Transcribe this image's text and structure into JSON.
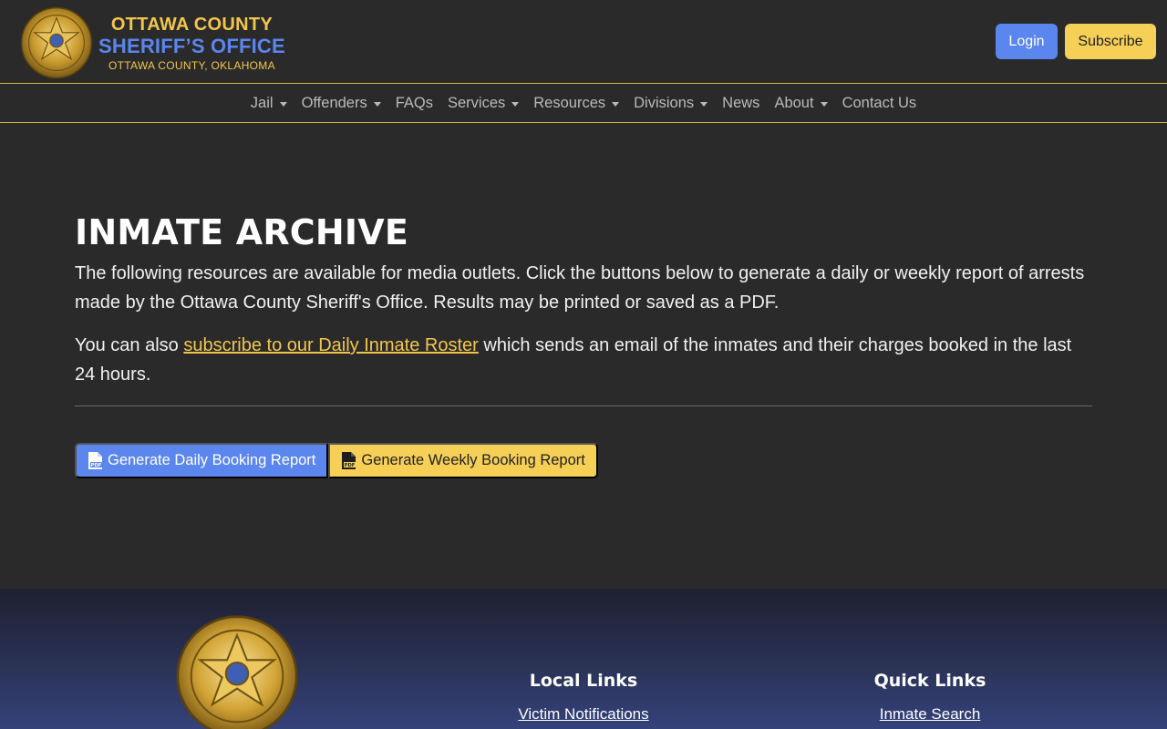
{
  "brand": {
    "line1": "OTTAWA COUNTY",
    "line2": "SHERIFF’S OFFICE",
    "line3": "OTTAWA COUNTY, OKLAHOMA",
    "badge_icon": "sheriff-star-badge",
    "colors": {
      "gold": "#f3c64b",
      "blue": "#5b86ee"
    }
  },
  "auth": {
    "login_label": "Login",
    "subscribe_label": "Subscribe"
  },
  "nav": {
    "items": [
      {
        "label": "Jail",
        "dropdown": true
      },
      {
        "label": "Offenders",
        "dropdown": true
      },
      {
        "label": "FAQs",
        "dropdown": false
      },
      {
        "label": "Services",
        "dropdown": true
      },
      {
        "label": "Resources",
        "dropdown": true
      },
      {
        "label": "Divisions",
        "dropdown": true
      },
      {
        "label": "News",
        "dropdown": false
      },
      {
        "label": "About",
        "dropdown": true
      },
      {
        "label": "Contact Us",
        "dropdown": false
      }
    ]
  },
  "main": {
    "title": "INMATE ARCHIVE",
    "intro": "The following resources are available for media outlets. Click the buttons below to generate a daily or weekly report of arrests made by the Ottawa County Sheriff's Office. Results may be printed or saved as a PDF.",
    "subscribe_prefix": "You can also ",
    "subscribe_link": "subscribe to our Daily Inmate Roster",
    "subscribe_suffix": " which sends an email of the inmates and their charges booked in the last 24 hours.",
    "daily_button": "Generate Daily Booking Report",
    "weekly_button": "Generate Weekly Booking Report",
    "button_icon": "pdf-file-icon"
  },
  "footer": {
    "local_links_title": "Local Links",
    "local_links": [
      "Victim Notifications"
    ],
    "quick_links_title": "Quick Links",
    "quick_links": [
      "Inmate Search"
    ]
  }
}
